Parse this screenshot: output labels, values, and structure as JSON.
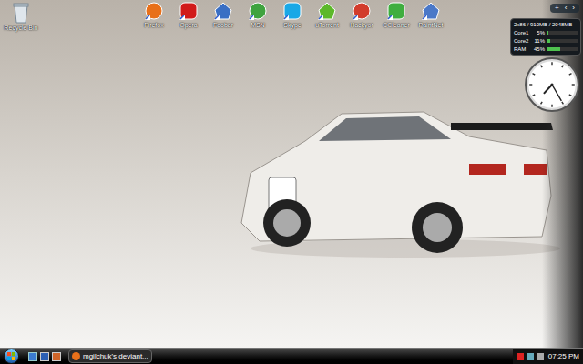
{
  "desktop": {
    "recycle_bin": {
      "label": "Recycle Bin"
    },
    "icons": [
      {
        "label": "Firefox"
      },
      {
        "label": "Opera"
      },
      {
        "label": "Foobar"
      },
      {
        "label": "MSN"
      },
      {
        "label": "Skype"
      },
      {
        "label": "uTorrent"
      },
      {
        "label": "Hackyor"
      },
      {
        "label": "CCleaner"
      },
      {
        "label": "PaintNet"
      }
    ]
  },
  "sidebar": {
    "controls": [
      "+",
      "‹",
      "›"
    ],
    "meter": {
      "header": "2x86 / 910MB / 2048MB",
      "rows": [
        {
          "label": "Core1",
          "reading": "5%",
          "level": 0.05
        },
        {
          "label": "Core2",
          "reading": "11%",
          "level": 0.11
        },
        {
          "label": "RAM",
          "reading": "45%",
          "level": 0.45
        }
      ]
    },
    "clock": {
      "hour": 7,
      "minute": 25
    }
  },
  "taskbar": {
    "tasks": [
      {
        "label": "mgilchuk's deviant...",
        "selected": false
      }
    ],
    "time": "07:25 PM"
  }
}
